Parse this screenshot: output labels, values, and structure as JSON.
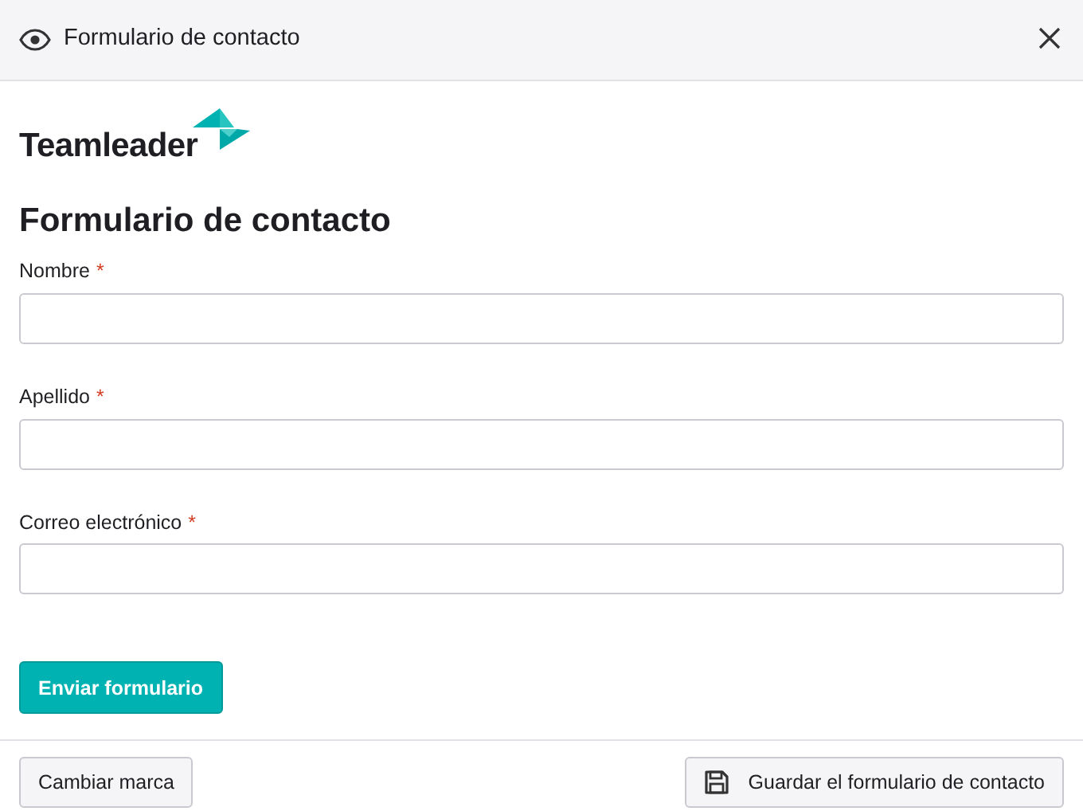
{
  "window": {
    "title": "Formulario de contacto"
  },
  "logo": {
    "text": "Teamleader"
  },
  "form": {
    "title": "Formulario de contacto",
    "fields": [
      {
        "label": "Nombre",
        "marker": "*"
      },
      {
        "label": "Apellido",
        "marker": "*"
      },
      {
        "label": "Correo electrónico",
        "marker": "*"
      }
    ],
    "submit": "Enviar formulario"
  },
  "footer": {
    "buttons": [
      {
        "label": "Cambiar marca",
        "kind": "plain"
      },
      {
        "label": "Guardar el formulario de contacto",
        "kind": "save"
      }
    ]
  }
}
